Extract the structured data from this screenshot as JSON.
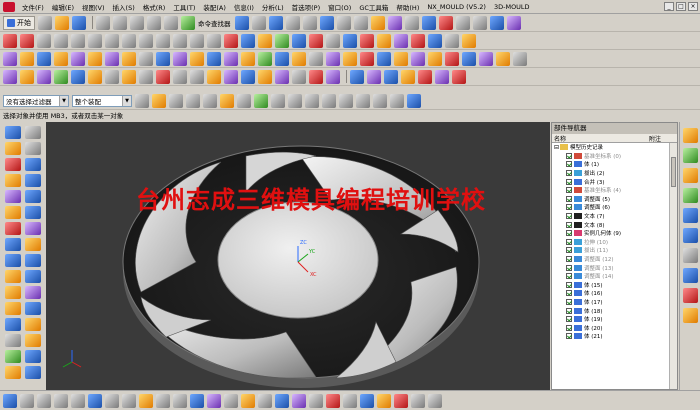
{
  "menu": {
    "items": [
      "文件(F)",
      "编辑(E)",
      "视图(V)",
      "插入(S)",
      "格式(R)",
      "工具(T)",
      "装配(A)",
      "信息(I)",
      "分析(L)",
      "首选项(P)",
      "窗口(O)",
      "GC工具箱",
      "帮助(H)",
      "NX_MOULD (V5.2)",
      "3D-MOULD"
    ],
    "window_buttons": [
      "_",
      "□",
      "×"
    ]
  },
  "toolbar": {
    "start_label": "开始",
    "command_finder": "命令查找器"
  },
  "selection_bar": {
    "filter_value": "没有选择过滤器",
    "assembly_value": "整个装配",
    "prompt": "选择对象并使用 MB3，或者双击某一对象"
  },
  "viewport": {
    "watermark": "台州志成三维模具编程培训学校",
    "axis_labels": {
      "z": "ZC",
      "y": "YC",
      "x": "XC"
    }
  },
  "navigator": {
    "title": "部件导航器",
    "col_name": "名称",
    "col_note": "附注",
    "root": "模型历史记录",
    "items": [
      {
        "label": "基准坐标系 (0)",
        "gray": true,
        "icon": "csys-icon"
      },
      {
        "label": "体 (1)",
        "gray": false,
        "icon": "body-icon"
      },
      {
        "label": "拔出 (2)",
        "gray": false,
        "icon": "extrude-icon"
      },
      {
        "label": "合并 (3)",
        "gray": false,
        "icon": "unite-icon"
      },
      {
        "label": "基准坐标系 (4)",
        "gray": true,
        "icon": "csys-icon"
      },
      {
        "label": "调整面 (5)",
        "gray": false,
        "icon": "face-icon"
      },
      {
        "label": "调整面 (6)",
        "gray": false,
        "icon": "face-icon"
      },
      {
        "label": "文本 (7)",
        "gray": false,
        "icon": "text-icon"
      },
      {
        "label": "文本 (8)",
        "gray": false,
        "icon": "text-icon"
      },
      {
        "label": "实例几何体 (9)",
        "gray": false,
        "icon": "instance-icon"
      },
      {
        "label": "拉伸 (10)",
        "gray": true,
        "icon": "extrude-icon"
      },
      {
        "label": "拔出 (11)",
        "gray": true,
        "icon": "extrude-icon"
      },
      {
        "label": "调整面 (12)",
        "gray": true,
        "icon": "face-icon"
      },
      {
        "label": "调整面 (13)",
        "gray": true,
        "icon": "face-icon"
      },
      {
        "label": "调整面 (14)",
        "gray": true,
        "icon": "face-icon"
      },
      {
        "label": "体 (15)",
        "gray": false,
        "icon": "body-icon"
      },
      {
        "label": "体 (16)",
        "gray": false,
        "icon": "body-icon"
      },
      {
        "label": "体 (17)",
        "gray": false,
        "icon": "body-icon"
      },
      {
        "label": "体 (18)",
        "gray": false,
        "icon": "body-icon"
      },
      {
        "label": "体 (19)",
        "gray": false,
        "icon": "body-icon"
      },
      {
        "label": "体 (20)",
        "gray": false,
        "icon": "body-icon"
      },
      {
        "label": "体 (21)",
        "gray": false,
        "icon": "body-icon"
      }
    ]
  }
}
